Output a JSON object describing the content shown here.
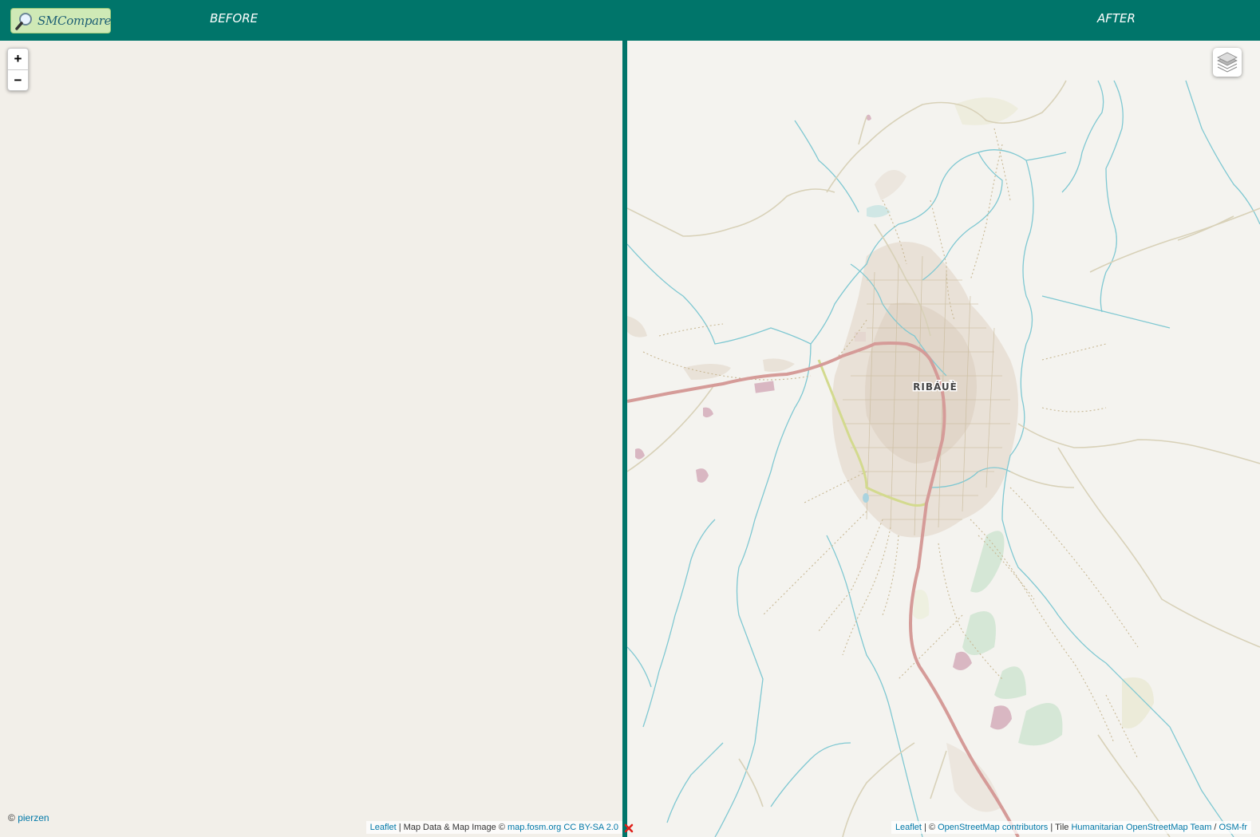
{
  "header": {
    "logo_text": "SMCompare",
    "before_label": "BEFORE",
    "after_label": "AFTER"
  },
  "zoom": {
    "in_label": "+",
    "out_label": "−"
  },
  "credit": {
    "prefix": "©",
    "author": "pierzen"
  },
  "attribution_left": {
    "leaflet": "Leaflet",
    "text": "| Map Data & Map Image ©",
    "source": "map.fosm.org",
    "license": "CC BY-SA 2.0"
  },
  "attribution_right": {
    "leaflet": "Leaflet",
    "sep1": "| ©",
    "osm": "OpenStreetMap contributors",
    "sep2": "| Tile",
    "hot": "Humanitarian OpenStreetMap Team",
    "sep3": "/",
    "osmfr": "OSM-fr"
  },
  "map": {
    "place_label": "RIBÁUÈ",
    "colors": {
      "header": "#00756a",
      "before_background": "#f2efe9",
      "after_background": "#f4f3ef",
      "trunk_road": "#d59b98",
      "secondary_road": "#d3da8e",
      "river": "#7fc8d2",
      "track": "#cbbf9f",
      "urban": "#e6ddd2",
      "landuse_pink": "#d9b7c2",
      "landuse_green": "#d5e7d6"
    }
  }
}
